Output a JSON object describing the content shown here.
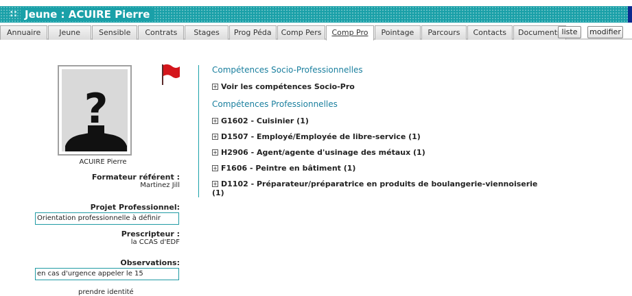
{
  "header": {
    "title": "Jeune : ACUIRE Pierre",
    "title_prefix": "::"
  },
  "tabs": [
    {
      "label": "Annuaire"
    },
    {
      "label": "Jeune"
    },
    {
      "label": "Sensible"
    },
    {
      "label": "Contrats"
    },
    {
      "label": "Stages"
    },
    {
      "label": "Prog Péda"
    },
    {
      "label": "Comp Pers"
    },
    {
      "label": "Comp Pro",
      "active": true
    },
    {
      "label": "Pointage"
    },
    {
      "label": "Parcours"
    },
    {
      "label": "Contacts"
    },
    {
      "label": "Documents"
    }
  ],
  "actions": {
    "list_label": "liste",
    "edit_label": "modifier"
  },
  "profile": {
    "name": "ACUIRE Pierre",
    "trainer_label": "Formateur référent :",
    "trainer_value": "Martinez Jill",
    "project_label": "Projet Professionnel:",
    "project_value": "Orientation professionnelle à définir",
    "prescriber_label": "Prescripteur :",
    "prescriber_value": "la CCAS d'EDF",
    "observations_label": "Observations:",
    "observations_value": "en cas d'urgence appeler le 15",
    "footer_text": "prendre identité"
  },
  "content": {
    "socio_title": "Compétences Socio-Professionnelles",
    "socio_link": "Voir les compétences Socio-Pro",
    "pro_title": "Compétences Professionnelles",
    "skills": [
      "G1602 - Cuisinier (1)",
      "D1507 - Employé/Employée de libre-service (1)",
      "H2906 - Agent/agente d'usinage des métaux (1)",
      "F1606 - Peintre en bâtiment (1)",
      "D1102 - Préparateur/préparatrice en produits de boulangerie-viennoiserie (1)"
    ],
    "skill_last_line1": "D1102 - Préparateur/préparatrice en produits de boulangerie-viennoiserie",
    "skill_last_line2": "(1)"
  },
  "colors": {
    "accent": "#1aa0a8",
    "link": "#1a7f9e",
    "flag": "#d4161c"
  }
}
